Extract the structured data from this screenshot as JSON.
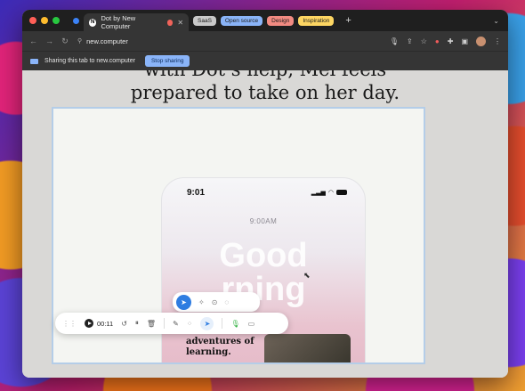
{
  "browser": {
    "active_tab": {
      "title": "Dot by New Computer",
      "favicon_letter": "N"
    },
    "tab_groups": [
      {
        "label": "SaaS",
        "color": "#c9c9c9"
      },
      {
        "label": "Open source",
        "color": "#8ab4f8"
      },
      {
        "label": "Design",
        "color": "#f28b82"
      },
      {
        "label": "Inspiration",
        "color": "#fdd663"
      }
    ],
    "new_tab_label": "+",
    "url": "new.computer"
  },
  "share_bar": {
    "message": "Sharing this tab to new.computer",
    "stop_button": "Stop sharing"
  },
  "page": {
    "headline_partial": "with Dot’s help, Mel feels",
    "headline": "prepared to take on her day."
  },
  "phone": {
    "time": "9:01",
    "clock": "9:00AM",
    "greeting_line1": "Good",
    "greeting_line2": "rning",
    "welcome": "and welcome the adventures of learning."
  },
  "recorder": {
    "timer": "00:11"
  },
  "colors": {
    "accent": "#2f7de1",
    "share_button": "#8ab4f8",
    "mic": "#3bb54a"
  }
}
